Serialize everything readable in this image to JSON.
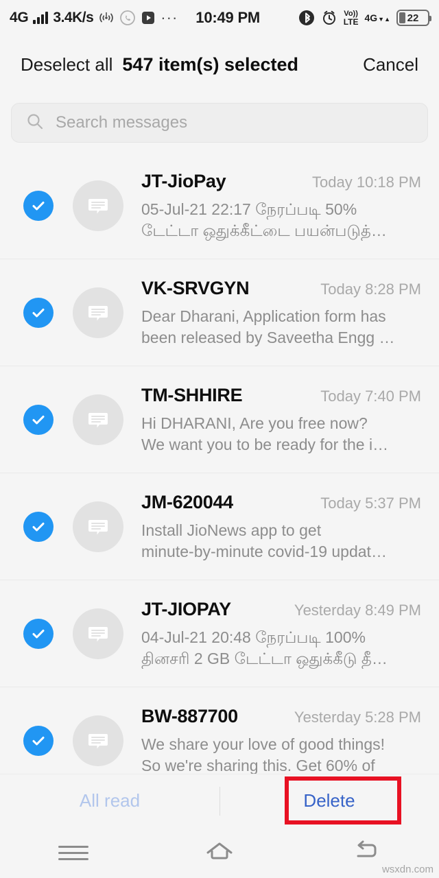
{
  "statusbar": {
    "network": "4G",
    "signal_icon": "signal-bars-icon",
    "data_speed": "3.4K/s",
    "hotspot_icon": "hotspot-icon",
    "whatsapp_icon": "whatsapp-icon",
    "video_icon": "video-play-icon",
    "overflow": "···",
    "clock": "10:49 PM",
    "bluetooth_icon": "bluetooth-icon",
    "alarm_icon": "alarm-clock-icon",
    "volte_top": "Vo))",
    "volte_bottom": "LTE",
    "mobile_data": "4G",
    "data_arrows": "▼▲",
    "battery_percent": "22"
  },
  "header": {
    "deselect_label": "Deselect all",
    "count_label": "547 item(s) selected",
    "cancel_label": "Cancel"
  },
  "search": {
    "icon": "search-icon",
    "placeholder": "Search messages",
    "value": ""
  },
  "messages": [
    {
      "sender": "JT-JioPay",
      "time": "Today 10:18 PM",
      "preview_line1": "05-Jul-21 22:17 நேரப்படி 50%",
      "preview_line2": "டேட்டா ஒதுக்கீட்டை பயன்படுத்…",
      "selected": true
    },
    {
      "sender": "VK-SRVGYN",
      "time": "Today 8:28 PM",
      "preview_line1": "Dear Dharani, Application form has",
      "preview_line2": "been released by Saveetha Engg …",
      "selected": true
    },
    {
      "sender": "TM-SHHIRE",
      "time": "Today 7:40 PM",
      "preview_line1": "Hi DHARANI, Are you free now?",
      "preview_line2": "We want you to be ready for the i…",
      "selected": true
    },
    {
      "sender": "JM-620044",
      "time": "Today 5:37 PM",
      "preview_line1": "Install JioNews app to get",
      "preview_line2": "minute-by-minute covid-19 updat…",
      "selected": true
    },
    {
      "sender": "JT-JIOPAY",
      "time": "Yesterday 8:49 PM",
      "preview_line1": "04-Jul-21 20:48 நேரப்படி 100%",
      "preview_line2": "தினசரி 2 GB டேட்டா ஒதுக்கீடு தீ…",
      "selected": true
    },
    {
      "sender": "BW-887700",
      "time": "Yesterday 5:28 PM",
      "preview_line1": "We share your love of good things!",
      "preview_line2": "So we're sharing this. Get 60% of",
      "selected": true
    }
  ],
  "actions": {
    "all_read_label": "All read",
    "delete_label": "Delete",
    "highlight_color": "#e81123",
    "primary_color": "#3763c8",
    "disabled_color": "#b2c6ec"
  },
  "navbar": {
    "menu_icon": "menu-icon",
    "home_icon": "home-icon",
    "back_icon": "back-icon"
  },
  "watermark": "wsxdn.com"
}
